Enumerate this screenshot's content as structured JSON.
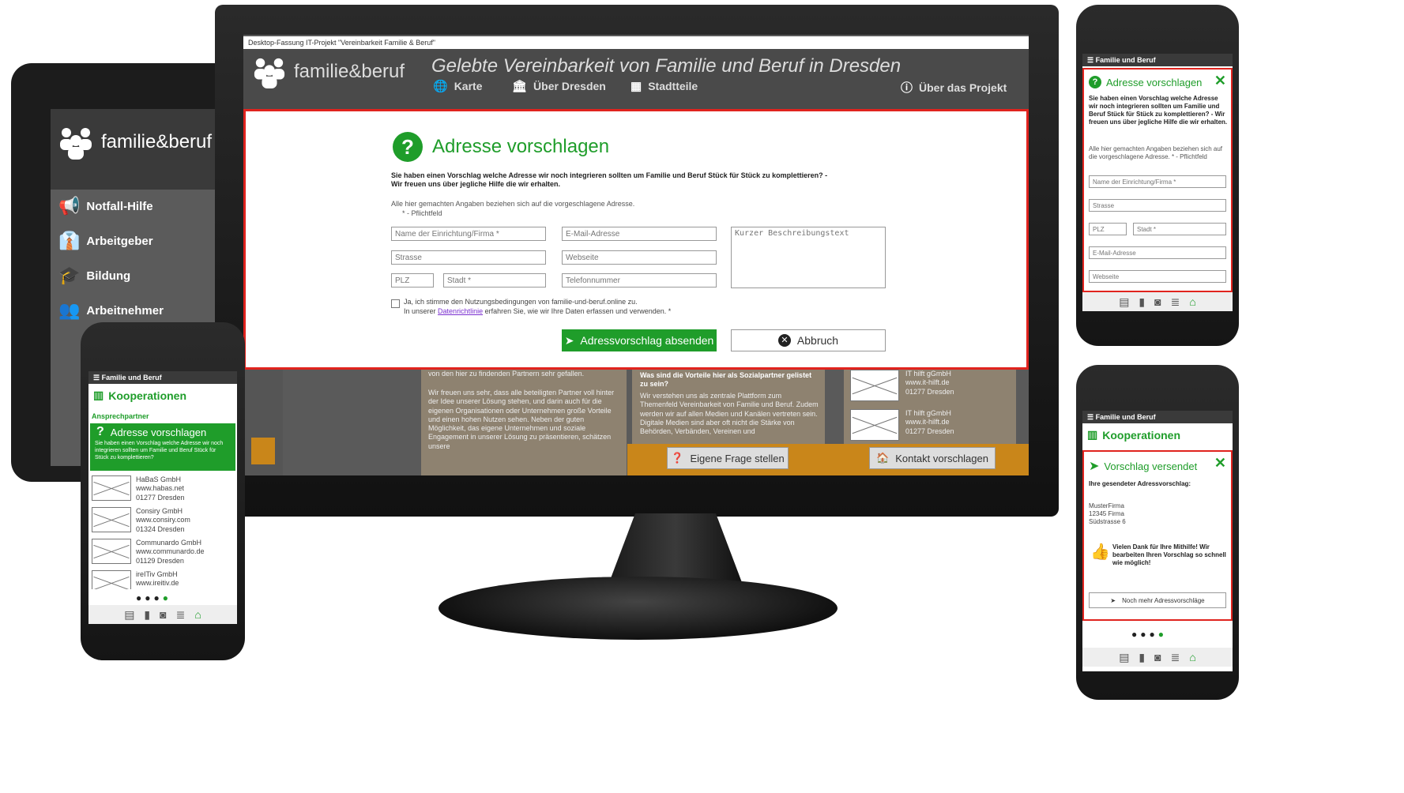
{
  "colors": {
    "accent": "#1f9d2a",
    "header_bg": "#4a4a4a",
    "frame": "#1c1c1c",
    "orange": "#c9861a",
    "red_outline": "#e0231e"
  },
  "tablet": {
    "brand": "familie&beruf",
    "nav": [
      {
        "label": "Notfall-Hilfe",
        "icon": "megaphone-icon"
      },
      {
        "label": "Arbeitgeber",
        "icon": "employer-icon"
      },
      {
        "label": "Bildung",
        "icon": "graduation-cap-icon"
      },
      {
        "label": "Arbeitnehmer",
        "icon": "people-icon"
      }
    ]
  },
  "desktop": {
    "window_title": "Desktop-Fassung IT-Projekt \"Vereinbarkeit Familie & Beruf\"",
    "brand": "familie&beruf",
    "headline": "Gelebte Vereinbarkeit von Familie und Beruf in Dresden",
    "menu": {
      "karte": "Karte",
      "ueber_dresden": "Über Dresden",
      "stadtteile": "Stadtteile",
      "ueber_projekt": "Über das Projekt"
    },
    "modal": {
      "title": "Adresse vorschlagen",
      "intro": "Sie haben einen Vorschlag welche Adresse wir noch integrieren sollten um Familie und Beruf Stück für Stück zu komplettieren? - Wir freuen uns über jegliche Hilfe die wir erhalten.",
      "note": "Alle hier gemachten Angaben beziehen sich auf die vorgeschlagene Adresse.",
      "note2": "* - Pflichtfeld",
      "fields": {
        "name": "Name der Einrichtung/Firma *",
        "strasse": "Strasse",
        "plz": "PLZ",
        "stadt": "Stadt *",
        "email": "E-Mail-Adresse",
        "webseite": "Webseite",
        "telefon": "Telefonnummer",
        "beschreibung": "Kurzer Beschreibungstext"
      },
      "consent1": "Ja, ich stimme den Nutzungsbedingungen von familie-und-beruf.online zu.",
      "consent2_pre": "In unserer",
      "consent2_link": "Datenrichtlinie",
      "consent2_post": "erfahren Sie, wie wir Ihre Daten erfassen und verwenden. *",
      "submit": "Adressvorschlag absenden",
      "cancel": "Abbruch"
    },
    "bg_text1": "von den hier zu findenden Partnern sehr gefallen.",
    "bg_text2": "Wir freuen uns sehr, dass alle beteiligten Partner voll hinter der Idee unserer Lösung stehen, und darin auch für die eigenen Organisationen oder Unternehmen große Vorteile und einen hohen Nutzen sehen. Neben der guten Möglichkeit, das eigene Unternehmen und soziale Engagement in unserer Lösung zu präsentieren, schätzen unsere",
    "bg_heading": "Was sind die Vorteile hier als Sozialpartner gelistet zu sein?",
    "bg_text3": "Wir verstehen uns als zentrale Plattform zum Themenfeld Vereinbarkeit von Familie und Beruf. Zudem werden wir auf allen Medien und Kanälen vertreten sein. Digitale Medien sind aber oft nicht die Stärke von Behörden, Verbänden, Vereinen und",
    "partners": [
      {
        "name": "IT hilft gGmbH",
        "web": "www.it-hilft.de",
        "city": "01277 Dresden"
      },
      {
        "name": "IT hilft gGmbH",
        "web": "www.it-hilft.de",
        "city": "01277 Dresden"
      }
    ],
    "btn_frage": "Eigene Frage stellen",
    "btn_kontakt": "Kontakt vorschlagen"
  },
  "phone_small": {
    "app_title": "Familie und Beruf",
    "section": "Kooperationen",
    "subsection": "Ansprechpartner",
    "banner_title": "Adresse vorschlagen",
    "banner_text": "Sie haben einen Vorschlag welche Adresse wir noch integrieren sollten um Familie und Beruf Stück für Stück zu komplettieren?",
    "list": [
      {
        "name": "HaBaS GmbH",
        "web": "www.habas.net",
        "city": "01277 Dresden"
      },
      {
        "name": "Consiry GmbH",
        "web": "www.consiry.com",
        "city": "01324 Dresden"
      },
      {
        "name": "Communardo GmbH",
        "web": "www.communardo.de",
        "city": "01129 Dresden"
      },
      {
        "name": "ireITiv GmbH",
        "web": "www.ireitiv.de",
        "city": ""
      }
    ]
  },
  "phone_top": {
    "app_title": "Familie und Beruf",
    "title": "Adresse vorschlagen",
    "intro": "Sie haben einen Vorschlag welche Adresse wir noch integrieren sollten um Familie und Beruf Stück für Stück zu komplettieren? - Wir freuen uns über jegliche Hilfe die wir erhalten.",
    "note": "Alle hier gemachten Angaben beziehen sich auf die vorgeschlagene Adresse. * - Pflichtfeld",
    "fields": {
      "name": "Name der Einrichtung/Firma *",
      "strasse": "Strasse",
      "plz": "PLZ",
      "stadt": "Stadt *",
      "email": "E-Mail-Adresse",
      "webseite": "Webseite"
    }
  },
  "phone_bottom": {
    "app_title": "Familie und Beruf",
    "section": "Kooperationen",
    "title": "Vorschlag versendet",
    "sent_label": "Ihre gesendeter Adressvorschlag:",
    "addr1": "MusterFirma",
    "addr2": "12345 Firma",
    "addr3": "Südstrasse 6",
    "thanks": "Vielen Dank für Ihre Mithilfe! Wir bearbeiten Ihren Vorschlag so schnell wie möglich!",
    "more": "Noch mehr Adressvorschläge"
  }
}
